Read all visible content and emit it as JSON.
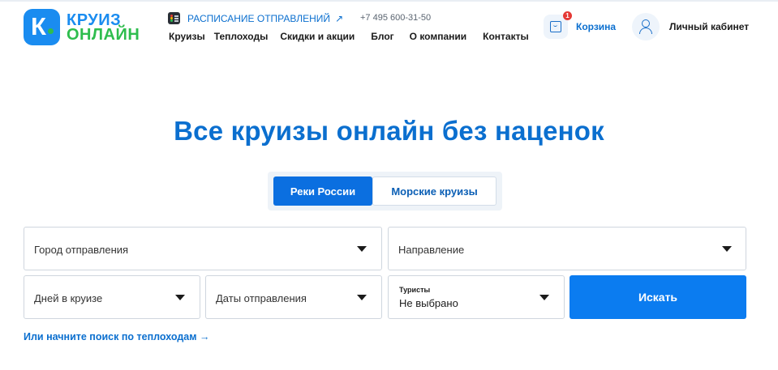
{
  "logo": {
    "line1": "КРУИЗ",
    "line2": "ОНЛАЙН",
    "badge_letter": "К"
  },
  "header": {
    "schedule_link": "РАСПИСАНИЕ ОТПРАВЛЕНИЙ",
    "schedule_arrow": "↗",
    "phone": "+7 495 600-31-50",
    "nav": [
      "Круизы",
      "Теплоходы",
      "Скидки и акции",
      "Блог",
      "О компании",
      "Контакты"
    ],
    "cart": {
      "label": "Корзина",
      "count": "1"
    },
    "account": {
      "label": "Личный кабинет"
    }
  },
  "hero": {
    "title": "Все круизы онлайн без наценок"
  },
  "tabs": [
    {
      "label": "Реки России",
      "active": true
    },
    {
      "label": "Морские круизы",
      "active": false
    }
  ],
  "search": {
    "departure_city": "Город отправления",
    "direction": "Направление",
    "days": "Дней в круизе",
    "dates": "Даты отправления",
    "tourists_label": "Туристы",
    "tourists_value": "Не выбрано",
    "search_button": "Искать",
    "alt_link": "Или начните поиск по теплоходам →"
  },
  "colors": {
    "brand_blue": "#0b6fcf",
    "brand_green": "#2ebd4e",
    "button_blue": "#0b7cf0",
    "badge_red": "#e53935"
  }
}
